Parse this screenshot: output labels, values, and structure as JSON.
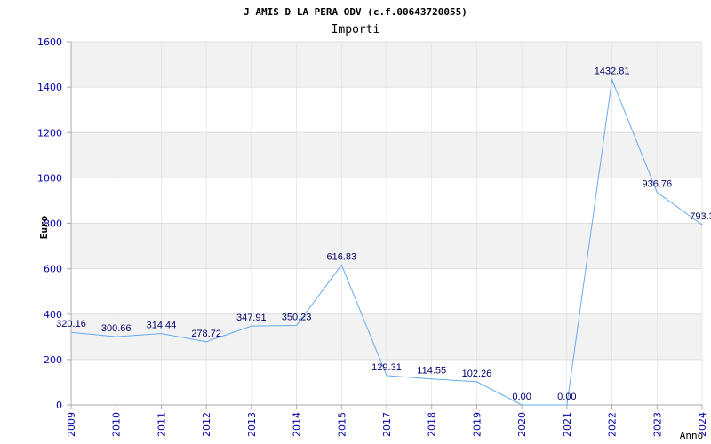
{
  "chart_data": {
    "type": "line",
    "title": "J AMIS D LA PERA ODV (c.f.00643720055)",
    "subtitle": "Importi",
    "xlabel": "Anno",
    "ylabel": "Euro",
    "ylim": [
      0,
      1600
    ],
    "yticks": [
      0,
      200,
      400,
      600,
      800,
      1000,
      1200,
      1400,
      1600
    ],
    "xticks": [
      "2009",
      "2010",
      "2011",
      "2012",
      "2013",
      "2014",
      "2015",
      "2017",
      "2018",
      "2019",
      "2020",
      "2021",
      "2022",
      "2023",
      "2024"
    ],
    "grid": true,
    "points": [
      {
        "x": "2009",
        "y": 320.16,
        "label": "320.16"
      },
      {
        "x": "2010",
        "y": 300.66,
        "label": "300.66"
      },
      {
        "x": "2011",
        "y": 314.44,
        "label": "314.44"
      },
      {
        "x": "2012",
        "y": 278.72,
        "label": "278.72"
      },
      {
        "x": "2013",
        "y": 347.91,
        "label": "347.91"
      },
      {
        "x": "2014",
        "y": 350.23,
        "label": "350.23"
      },
      {
        "x": "2015",
        "y": 616.83,
        "label": "616.83"
      },
      {
        "x": "2017",
        "y": 129.31,
        "label": "129.31"
      },
      {
        "x": "2018",
        "y": 114.55,
        "label": "114.55"
      },
      {
        "x": "2019",
        "y": 102.26,
        "label": "102.26"
      },
      {
        "x": "2020",
        "y": 0.0,
        "label": "0.00"
      },
      {
        "x": "2021",
        "y": 0.0,
        "label": "0.00"
      },
      {
        "x": "2022",
        "y": 1432.81,
        "label": "1432.81"
      },
      {
        "x": "2023",
        "y": 936.76,
        "label": "936.76"
      },
      {
        "x": "2024",
        "y": 793.3,
        "label": "793.3"
      }
    ],
    "colors": {
      "line": "#66aaee",
      "band": "#f2f2f2",
      "grid": "#dddddd",
      "tick_text": "#0000aa",
      "label_text": "#000066"
    }
  }
}
